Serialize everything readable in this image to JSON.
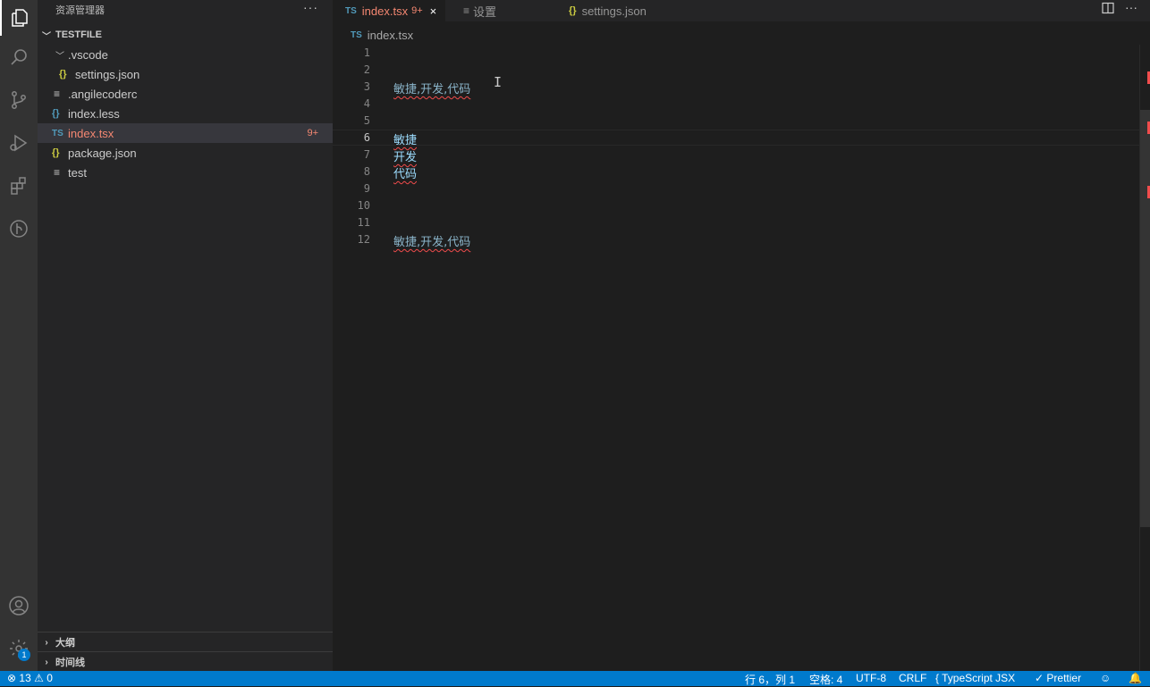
{
  "sidebar": {
    "title": "资源管理器",
    "more": "···",
    "workspace": "TESTFILE",
    "tree": [
      {
        "label": ".vscode",
        "icon": "chevron-down"
      },
      {
        "label": "settings.json",
        "icon": "{}"
      },
      {
        "label": ".angilecoderc",
        "icon": "≡"
      },
      {
        "label": "index.less",
        "icon": "{}"
      },
      {
        "label": "index.tsx",
        "icon": "TS",
        "count": "9+"
      },
      {
        "label": "package.json",
        "icon": "{}"
      },
      {
        "label": "test",
        "icon": "≡"
      }
    ],
    "outline": "大纲",
    "timeline": "时间线"
  },
  "activity": {
    "settings_badge": "1"
  },
  "tabs": [
    {
      "icon": "TS",
      "label": "index.tsx",
      "count": "9+",
      "close": "×"
    },
    {
      "icon": "≡",
      "label": "设置"
    },
    {
      "icon": "{}",
      "label": "settings.json"
    }
  ],
  "breadcrumb": {
    "icon": "TS",
    "file": "index.tsx"
  },
  "editor": {
    "line_numbers": [
      "1",
      "2",
      "3",
      "4",
      "5",
      "6",
      "7",
      "8",
      "9",
      "10",
      "11",
      "12"
    ],
    "lines": {
      "l3": "敏捷,开发,代码",
      "l6": "敏捷",
      "l7": "开发",
      "l8": "代码",
      "l12": "敏捷,开发,代码"
    },
    "cursor_glyph": "I"
  },
  "statusbar": {
    "errors": "13",
    "warnings": "0",
    "position": "行 6，列 1",
    "spaces": "空格: 4",
    "encoding": "UTF-8",
    "eol": "CRLF",
    "language": "TypeScript JSX",
    "formatter": "Prettier"
  },
  "colors": {
    "accent": "#007acc",
    "error": "#f48771",
    "json_icon": "#cbcb41",
    "ts_icon": "#519aba"
  }
}
